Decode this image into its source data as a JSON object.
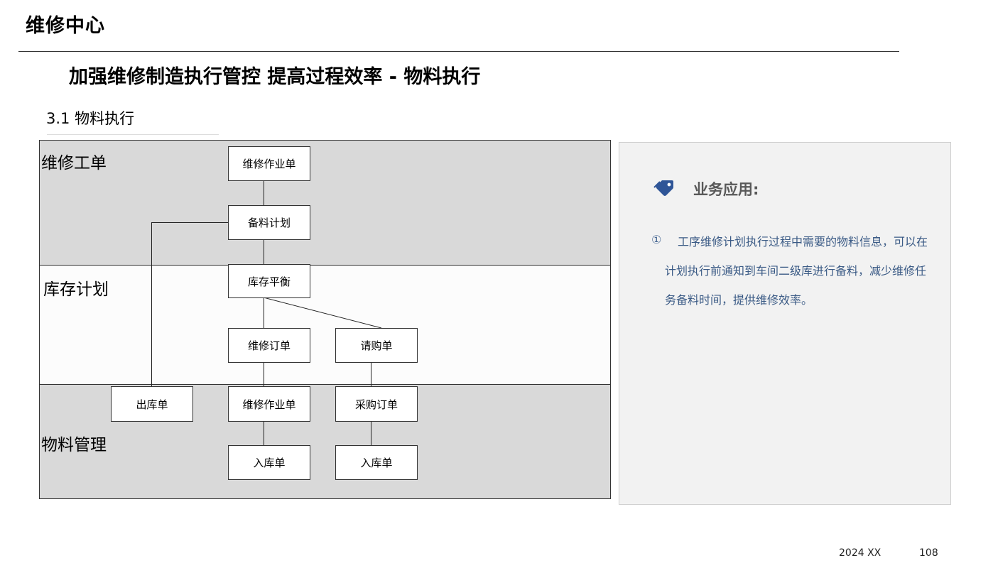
{
  "header": {
    "title": "维修中心"
  },
  "main_title": "加强维修制造执行管控 提高过程效率 - 物料执行",
  "section_title": "3.1 物料执行",
  "lanes": [
    {
      "label": "维修工单"
    },
    {
      "label": "库存计划"
    },
    {
      "label": "物料管理"
    }
  ],
  "nodes": {
    "maint_work_order_top": "维修作业单",
    "material_plan": "备料计划",
    "inventory_balance": "库存平衡",
    "maint_order": "维修订单",
    "purchase_request": "请购单",
    "issue_slip": "出库单",
    "maint_work_order_bottom": "维修作业单",
    "purchase_order": "采购订单",
    "receipt_left": "入库单",
    "receipt_right": "入库单"
  },
  "panel": {
    "icon": "tag-icon",
    "heading": "业务应用:",
    "item_number": "①",
    "item_text": "工序维修计划执行过程中需要的物料信息，可以在计划执行前通知到车间二级库进行备料，减少维修任务备料时间，提供维修效率。"
  },
  "footer": {
    "date": "2024 XX",
    "page": "108"
  },
  "colors": {
    "lane_gray": "#d9d9d9",
    "lane_white": "#fcfcfc",
    "panel_bg": "#f2f2f2",
    "panel_text": "#3a5a85",
    "icon_blue": "#2f5597"
  }
}
